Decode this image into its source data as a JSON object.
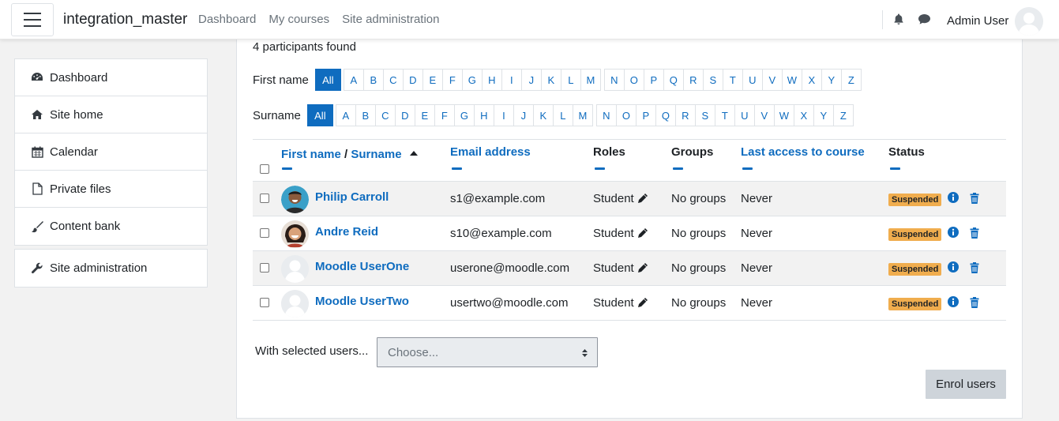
{
  "navbar": {
    "site_name": "integration_master",
    "links": [
      "Dashboard",
      "My courses",
      "Site administration"
    ],
    "user_name": "Admin User"
  },
  "sidebar": {
    "items": [
      {
        "label": "Dashboard",
        "icon": "dashboard-icon"
      },
      {
        "label": "Site home",
        "icon": "home-icon"
      },
      {
        "label": "Calendar",
        "icon": "calendar-icon"
      },
      {
        "label": "Private files",
        "icon": "file-icon"
      },
      {
        "label": "Content bank",
        "icon": "paintbrush-icon"
      }
    ],
    "admin": {
      "label": "Site administration",
      "icon": "wrench-icon"
    }
  },
  "participants": {
    "found_text": "4 participants found",
    "firstname_label": "First name",
    "surname_label": "Surname",
    "all_label": "All",
    "letters_a_m": [
      "A",
      "B",
      "C",
      "D",
      "E",
      "F",
      "G",
      "H",
      "I",
      "J",
      "K",
      "L",
      "M"
    ],
    "letters_n_z": [
      "N",
      "O",
      "P",
      "Q",
      "R",
      "S",
      "T",
      "U",
      "V",
      "W",
      "X",
      "Y",
      "Z"
    ],
    "columns": {
      "first_name": "First name",
      "slash": " / ",
      "surname": "Surname",
      "email": "Email address",
      "roles": "Roles",
      "groups": "Groups",
      "last_access": "Last access to course",
      "status": "Status"
    },
    "rows": [
      {
        "name": "Philip Carroll",
        "email": "s1@example.com",
        "role": "Student",
        "groups": "No groups",
        "last_access": "Never",
        "status": "Suspended",
        "avatar": "photo"
      },
      {
        "name": "Andre Reid",
        "email": "s10@example.com",
        "role": "Student",
        "groups": "No groups",
        "last_access": "Never",
        "status": "Suspended",
        "avatar": "photo"
      },
      {
        "name": "Moodle UserOne",
        "email": "userone@moodle.com",
        "role": "Student",
        "groups": "No groups",
        "last_access": "Never",
        "status": "Suspended",
        "avatar": "default"
      },
      {
        "name": "Moodle UserTwo",
        "email": "usertwo@moodle.com",
        "role": "Student",
        "groups": "No groups",
        "last_access": "Never",
        "status": "Suspended",
        "avatar": "default"
      }
    ],
    "with_selected_label": "With selected users...",
    "select_placeholder": "Choose...",
    "enrol_button": "Enrol users"
  },
  "colors": {
    "link": "#0f6cbf",
    "badge_warning": "#f0ad4e",
    "row_stripe": "#f2f2f2"
  }
}
